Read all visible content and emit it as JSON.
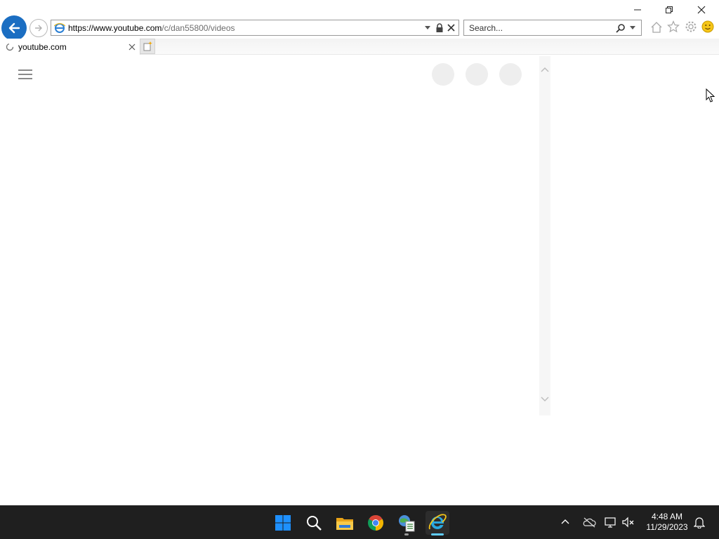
{
  "browser": {
    "address_host": "https://www.youtube.com",
    "address_path": "/c/dan55800/videos",
    "search_placeholder": "Search...",
    "tab_title": "youtube.com"
  },
  "taskbar": {
    "time": "4:48 AM",
    "date": "11/29/2023"
  },
  "colors": {
    "ie_accent": "#1b6ec2",
    "taskbar_bg": "#1f1f1f",
    "windows_blue": "#1e90ff"
  }
}
